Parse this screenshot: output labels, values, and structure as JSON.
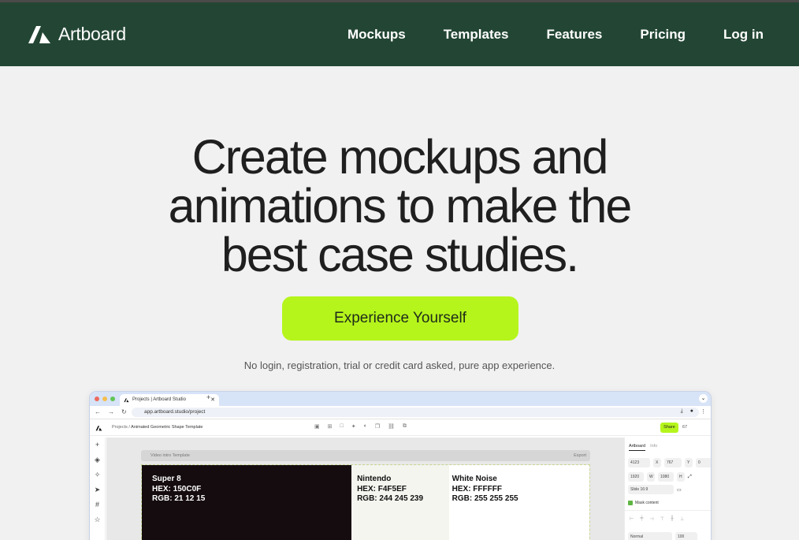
{
  "header": {
    "brand": "Artboard",
    "nav": [
      "Mockups",
      "Templates",
      "Features",
      "Pricing",
      "Log in"
    ]
  },
  "hero": {
    "title_lines": [
      "Create mockups and",
      "animations to make the",
      "best case studies."
    ],
    "cta": "Experience Yourself",
    "note": "No login, registration, trial or credit card asked, pure app experience."
  },
  "preview": {
    "tab_title": "Projects | Artboard Studio",
    "url": "app.artboard.studio/project",
    "breadcrumb_parent": "Projects /",
    "breadcrumb_current": "Animated Geometric Shape Template",
    "share": "Share",
    "zoom": "67",
    "canvas_title": "Video intro Template",
    "export": "Export",
    "panel_tabs": [
      "Artboard",
      "Info"
    ],
    "fields": {
      "x": "4123",
      "x_label": "X",
      "y": "767",
      "y_label": "Y",
      "rotation": "0",
      "w": "1920",
      "w_label": "W",
      "h": "1080",
      "h_label": "H",
      "ratio": "Slide 16:9",
      "blend": "Normal",
      "opacity": "100"
    },
    "mask_label": "Mask content",
    "swatches": [
      {
        "name": "Super 8",
        "hex": "HEX: 150C0F",
        "rgb": "RGB: 21 12 15",
        "color": "#150C0F"
      },
      {
        "name": "Nintendo",
        "hex": "HEX: F4F5EF",
        "rgb": "RGB: 244 245 239",
        "color": "#F4F5EF"
      },
      {
        "name": "White Noise",
        "hex": "HEX: FFFFFF",
        "rgb": "RGB: 255 255 255",
        "color": "#FFFFFF"
      }
    ]
  },
  "colors": {
    "header_bg": "#234634",
    "accent": "#B5F51C",
    "page_bg": "#F1F1F1"
  }
}
